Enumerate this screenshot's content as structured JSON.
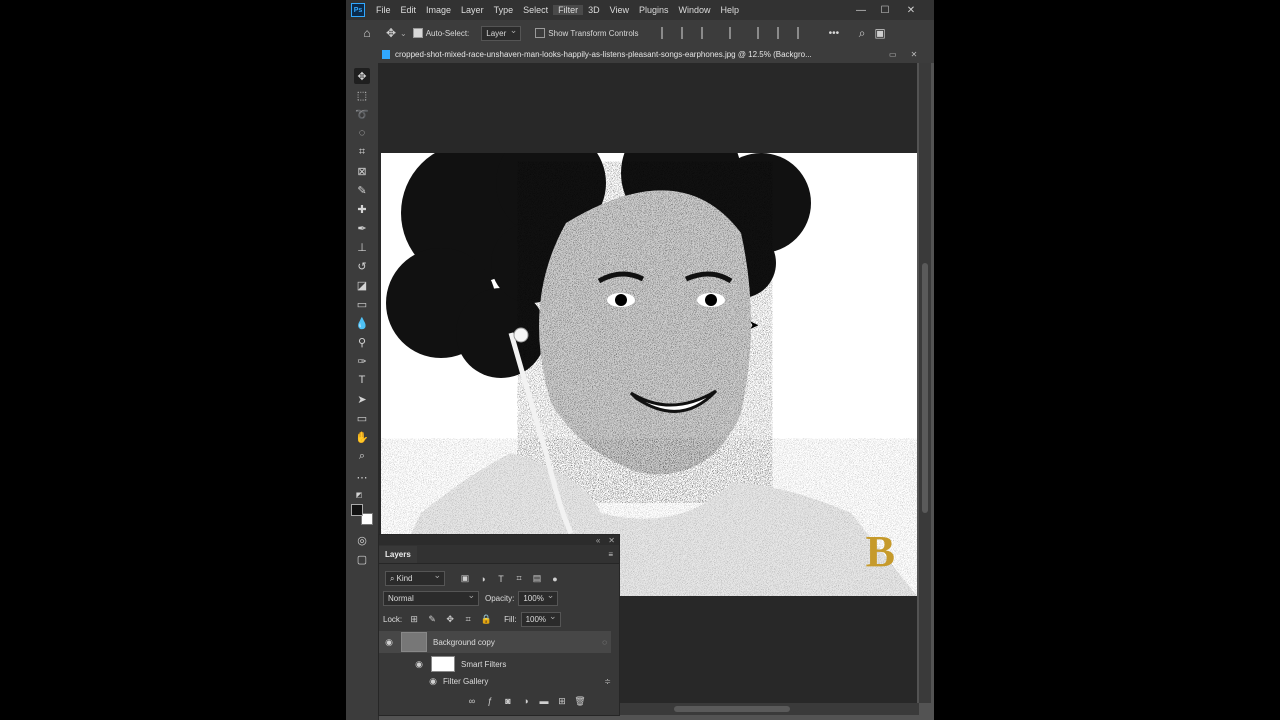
{
  "app": {
    "logo": "Ps"
  },
  "menu": [
    "File",
    "Edit",
    "Image",
    "Layer",
    "Type",
    "Select",
    "Filter",
    "3D",
    "View",
    "Plugins",
    "Window",
    "Help"
  ],
  "menu_active": "Filter",
  "window_controls": {
    "minimize": "—",
    "maximize": "☐",
    "close": "✕"
  },
  "options": {
    "auto_select_label": "Auto-Select:",
    "auto_select_target": "Layer",
    "show_transform_label": "Show Transform Controls",
    "more": "•••"
  },
  "document": {
    "tab_title": "cropped-shot-mixed-race-unshaven-man-looks-happily-as-listens-pleasant-songs-earphones.jpg @ 12.5% (Backgro..."
  },
  "canvas": {
    "watermark": "B"
  },
  "layers_panel": {
    "tab_label": "Layers",
    "kind_label": "Kind",
    "blend_mode": "Normal",
    "opacity_label": "Opacity:",
    "opacity_value": "100%",
    "lock_label": "Lock:",
    "fill_label": "Fill:",
    "fill_value": "100%",
    "layers": [
      {
        "name": "Background copy"
      },
      {
        "name": "Smart Filters"
      },
      {
        "name": "Filter Gallery"
      }
    ]
  },
  "colors": {
    "accent": "#31a8ff",
    "panel": "#383838",
    "app_bg": "#535353",
    "menubar": "#323232"
  },
  "icons": {
    "tools": [
      "move-icon",
      "marquee-icon",
      "lasso-icon",
      "quick-select-icon",
      "crop-icon",
      "frame-icon",
      "eyedropper-icon",
      "healing-icon",
      "brush-icon",
      "stamp-icon",
      "history-brush-icon",
      "eraser-icon",
      "gradient-icon",
      "blur-icon",
      "dodge-icon",
      "pen-icon",
      "type-icon",
      "path-select-icon",
      "rectangle-icon",
      "hand-icon",
      "zoom-icon",
      "more-tools-icon"
    ]
  }
}
